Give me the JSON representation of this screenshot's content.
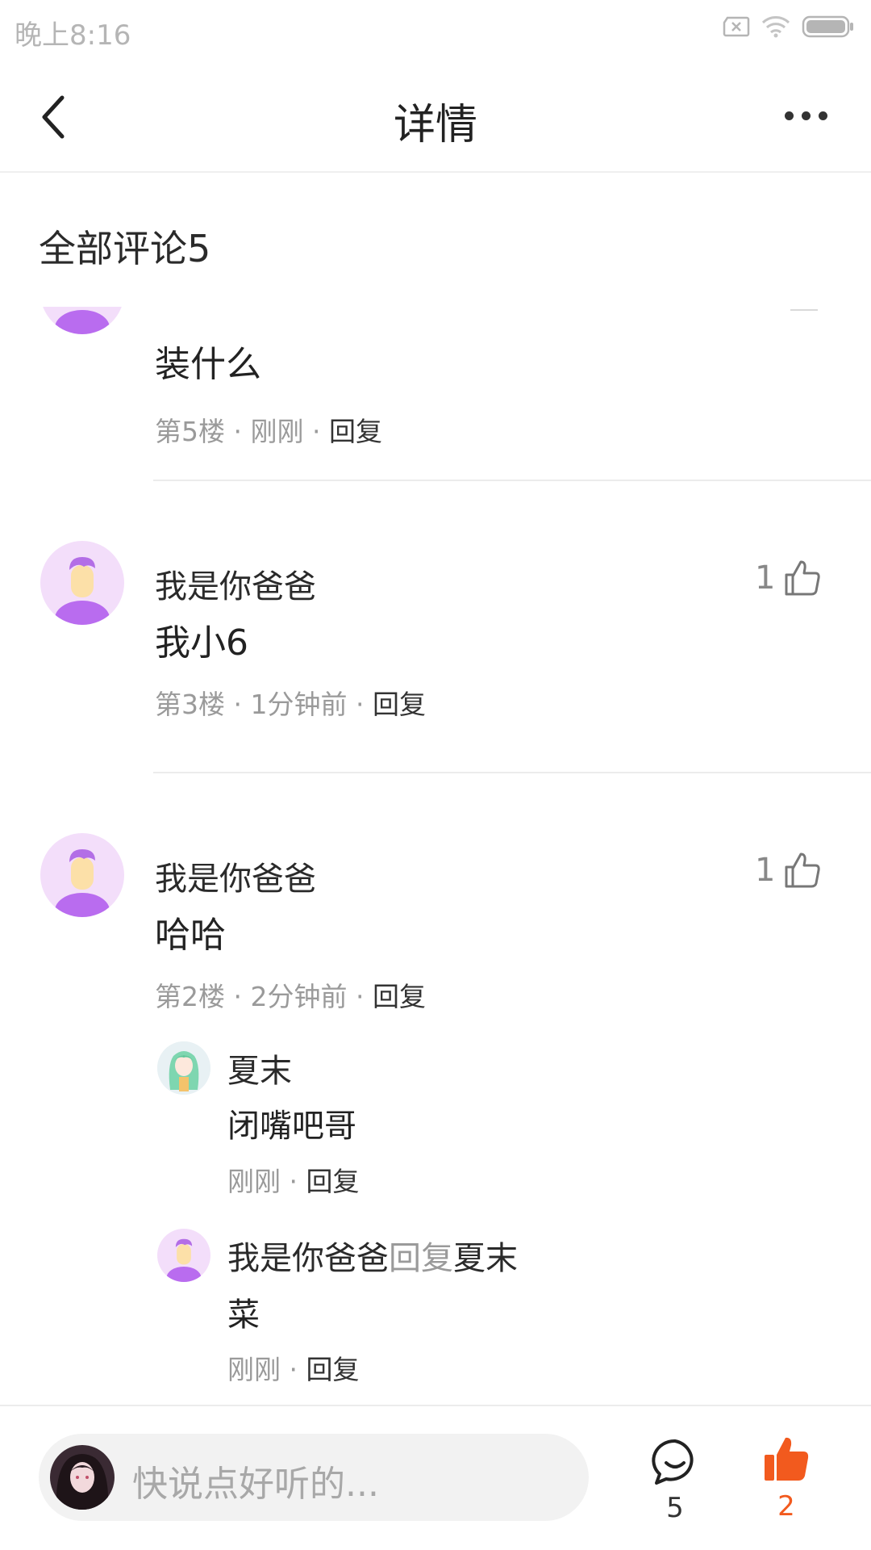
{
  "status_bar": {
    "time": "晚上8:16"
  },
  "header": {
    "title": "详情"
  },
  "section": {
    "title": "全部评论5"
  },
  "comments": [
    {
      "content": "装什么",
      "floor": "第5楼",
      "time": "刚刚",
      "reply": "回复"
    },
    {
      "author": "我是你爸爸",
      "likes": "1",
      "content": "我小6",
      "floor": "第3楼",
      "time": "1分钟前",
      "reply": "回复"
    },
    {
      "author": "我是你爸爸",
      "likes": "1",
      "content": "哈哈",
      "floor": "第2楼",
      "time": "2分钟前",
      "reply": "回复",
      "replies": [
        {
          "author": "夏末",
          "content": "闭嘴吧哥",
          "time": "刚刚",
          "reply": "回复"
        },
        {
          "author": "我是你爸爸",
          "reply_word": "回复",
          "reply_to": "夏末",
          "content": "菜",
          "time": "刚刚",
          "reply": "回复"
        }
      ]
    }
  ],
  "meta_separator": "·",
  "bottom_bar": {
    "placeholder": "快说点好听的...",
    "comment_count": "5",
    "like_count": "2"
  },
  "colors": {
    "accent": "#f25a1e",
    "avatar_bg": "#f3defa",
    "avatar_hair": "#b36ee6",
    "avatar_face": "#fbe0a8"
  }
}
